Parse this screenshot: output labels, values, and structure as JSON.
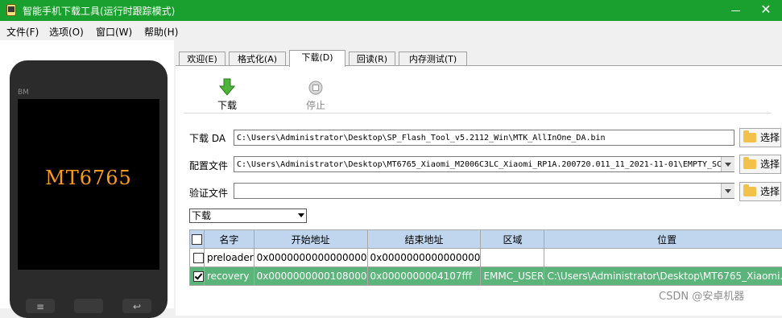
{
  "window": {
    "title": "智能手机下载工具(运行时跟踪模式)"
  },
  "menu": [
    {
      "label": "文件(F)"
    },
    {
      "label": "选项(O)"
    },
    {
      "label": "窗口(W)"
    },
    {
      "label": "帮助(H)"
    }
  ],
  "phone": {
    "brand": "BM",
    "chip": "MT6765"
  },
  "tabs": [
    {
      "label": "欢迎(E)"
    },
    {
      "label": "格式化(A)"
    },
    {
      "label": "下载(D)",
      "active": true
    },
    {
      "label": "回读(R)"
    },
    {
      "label": "内存测试(T)"
    }
  ],
  "toolbar": {
    "download_label": "下载",
    "stop_label": "停止"
  },
  "fields": {
    "da": {
      "label": "下载 DA",
      "value": "C:\\Users\\Administrator\\Desktop\\SP_Flash_Tool_v5.2112_Win\\MTK_AllInOne_DA.bin",
      "button": "选择"
    },
    "scatter": {
      "label": "配置文件",
      "value": "C:\\Users\\Administrator\\Desktop\\MT6765_Xiaomi_M2006C3LC_Xiaomi_RP1A.200720.011_11_2021-11-01\\EMPTY_SC",
      "button": "选择"
    },
    "auth": {
      "label": "验证文件",
      "value": "",
      "button": "选择"
    }
  },
  "mode_select": {
    "value": "下载"
  },
  "table": {
    "headers": [
      "名字",
      "开始地址",
      "结束地址",
      "区域",
      "位置"
    ],
    "rows": [
      {
        "checked": false,
        "name": "preloader",
        "start": "0x0000000000000000",
        "end": "0x0000000000000000",
        "region": "",
        "location": ""
      },
      {
        "checked": true,
        "name": "recovery",
        "start": "0x0000000000108000",
        "end": "0x0000000004107fff",
        "region": "EMMC_USER",
        "location": "C:\\Users\\Administrator\\Desktop\\MT6765_Xiaomi..."
      }
    ]
  },
  "watermark": "CSDN @安卓机器",
  "colors": {
    "title_bar": "#1aa02e",
    "selected_row": "#5bb479",
    "table_header": "#bfd6ee",
    "chip_text": "#ff9a1a"
  }
}
